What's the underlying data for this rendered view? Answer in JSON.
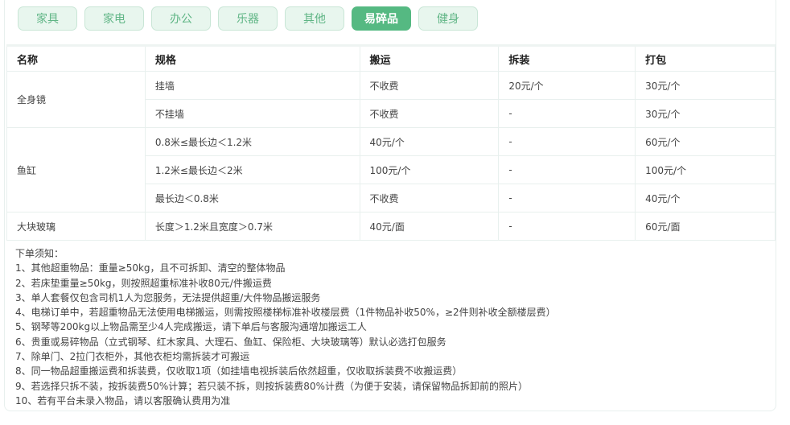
{
  "tabs": [
    {
      "label": "家具"
    },
    {
      "label": "家电"
    },
    {
      "label": "办公"
    },
    {
      "label": "乐器"
    },
    {
      "label": "其他"
    },
    {
      "label": "易碎品",
      "active": true
    },
    {
      "label": "健身"
    }
  ],
  "accent": "#55b982",
  "table": {
    "headers": [
      "名称",
      "规格",
      "搬运",
      "拆装",
      "打包"
    ],
    "groups": [
      {
        "name": "全身镜",
        "rows": [
          [
            "挂墙",
            "不收费",
            "20元/个",
            "30元/个"
          ],
          [
            "不挂墙",
            "不收费",
            "-",
            "30元/个"
          ]
        ]
      },
      {
        "name": "鱼缸",
        "rows": [
          [
            "0.8米≤最长边＜1.2米",
            "40元/个",
            "-",
            "60元/个"
          ],
          [
            "1.2米≤最长边＜2米",
            "100元/个",
            "-",
            "100元/个"
          ],
          [
            "最长边＜0.8米",
            "不收费",
            "-",
            "40元/个"
          ]
        ]
      },
      {
        "name": "大块玻璃",
        "rows": [
          [
            "长度＞1.2米且宽度＞0.7米",
            "40元/面",
            "-",
            "60元/面"
          ]
        ]
      }
    ]
  },
  "notes": {
    "title": "下单须知：",
    "items": [
      "1、其他超重物品：重量≥50kg，且不可拆卸、清空的整体物品",
      "2、若床垫重量≥50kg，则按照超重标准补收80元/件搬运费",
      "3、单人套餐仅包含司机1人为您服务，无法提供超重/大件物品搬运服务",
      "4、电梯订单中，若超重物品无法使用电梯搬运，则需按照楼梯标准补收楼层费（1件物品补收50%，≥2件则补收全额楼层费）",
      "5、钢琴等200kg以上物品需至少4人完成搬运，请下单后与客服沟通增加搬运工人",
      "6、贵重或易碎物品（立式钢琴、红木家具、大理石、鱼缸、保险柜、大块玻璃等）默认必选打包服务",
      "7、除单门、2拉门衣柜外，其他衣柜均需拆装才可搬运",
      "8、同一物品超重搬运费和拆装费，仅收取1项（如挂墙电视拆装后依然超重，仅收取拆装费不收搬运费）",
      "9、若选择只拆不装，按拆装费50%计算；若只装不拆，则按拆装费80%计费（为便于安装，请保留物品拆卸前的照片）",
      "10、若有平台未录入物品，请以客服确认费用为准"
    ]
  }
}
